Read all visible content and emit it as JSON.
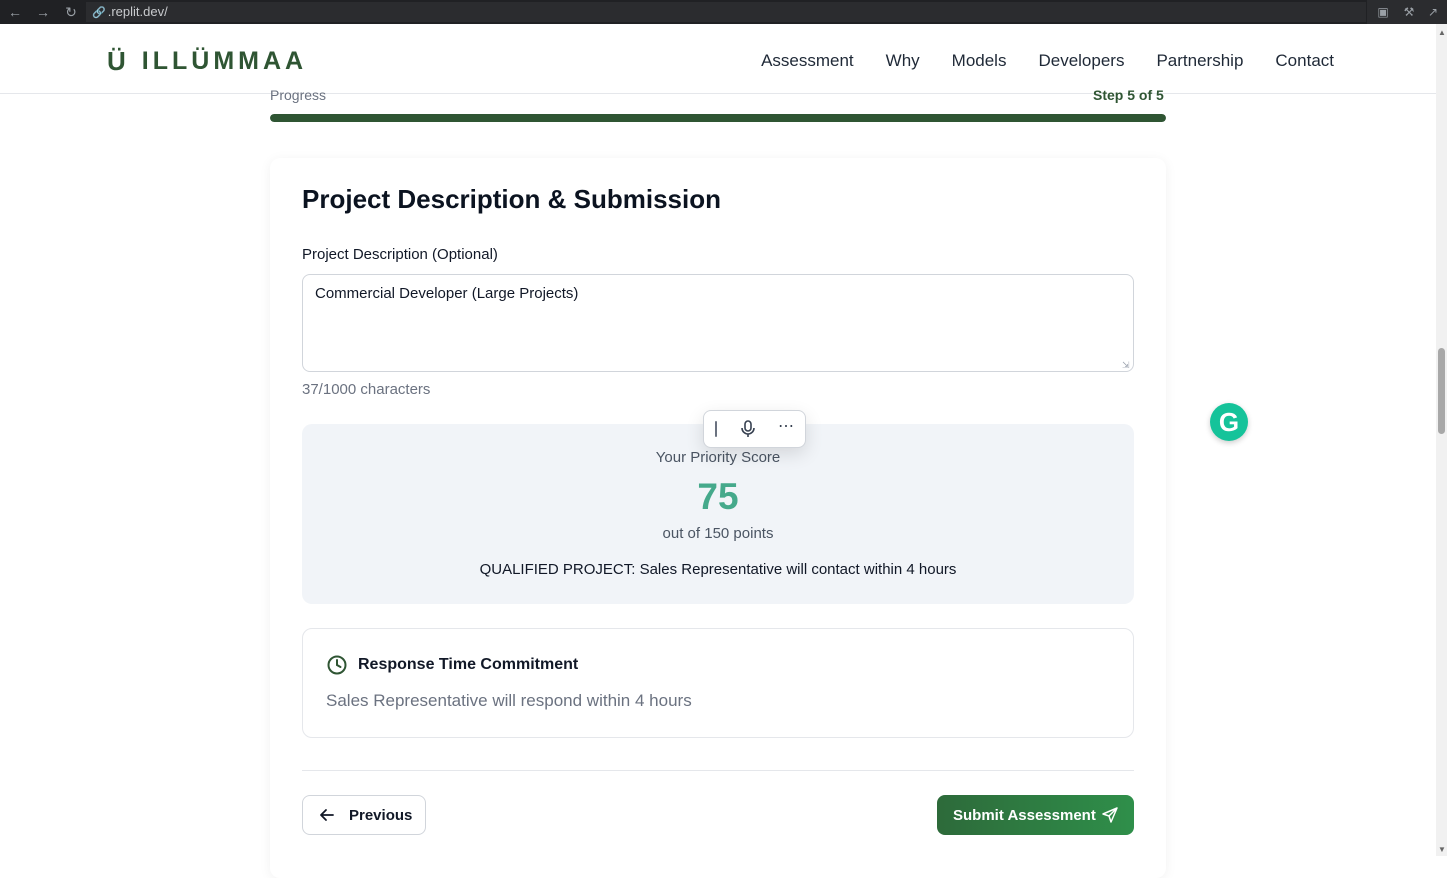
{
  "browser": {
    "url": ".replit.dev/",
    "back_icon": "arrow-left-icon",
    "forward_icon": "arrow-right-icon",
    "reload_icon": "reload-icon"
  },
  "header": {
    "logo_text": "ILLÜMMAA",
    "logo_mark": "Ü",
    "nav": [
      "Assessment",
      "Why",
      "Models",
      "Developers",
      "Partnership",
      "Contact"
    ]
  },
  "progress": {
    "label": "Progress",
    "step_text": "Step 5 of 5",
    "fraction": 1.0
  },
  "form": {
    "title": "Project Description & Submission",
    "description_label": "Project Description (Optional)",
    "description_value": "Commercial Developer (Large Projects)",
    "char_count": "37/1000 characters"
  },
  "score": {
    "title": "Your Priority Score",
    "value": "75",
    "out_of": "out of 150 points",
    "status": "QUALIFIED PROJECT: Sales Representative will contact within 4 hours"
  },
  "response": {
    "title": "Response Time Commitment",
    "text": "Sales Representative will respond within 4 hours"
  },
  "buttons": {
    "previous": "Previous",
    "submit": "Submit Assessment"
  },
  "colors": {
    "brand_green": "#2f5533",
    "score_teal": "#45a98b",
    "grammarly": "#15c39a"
  }
}
